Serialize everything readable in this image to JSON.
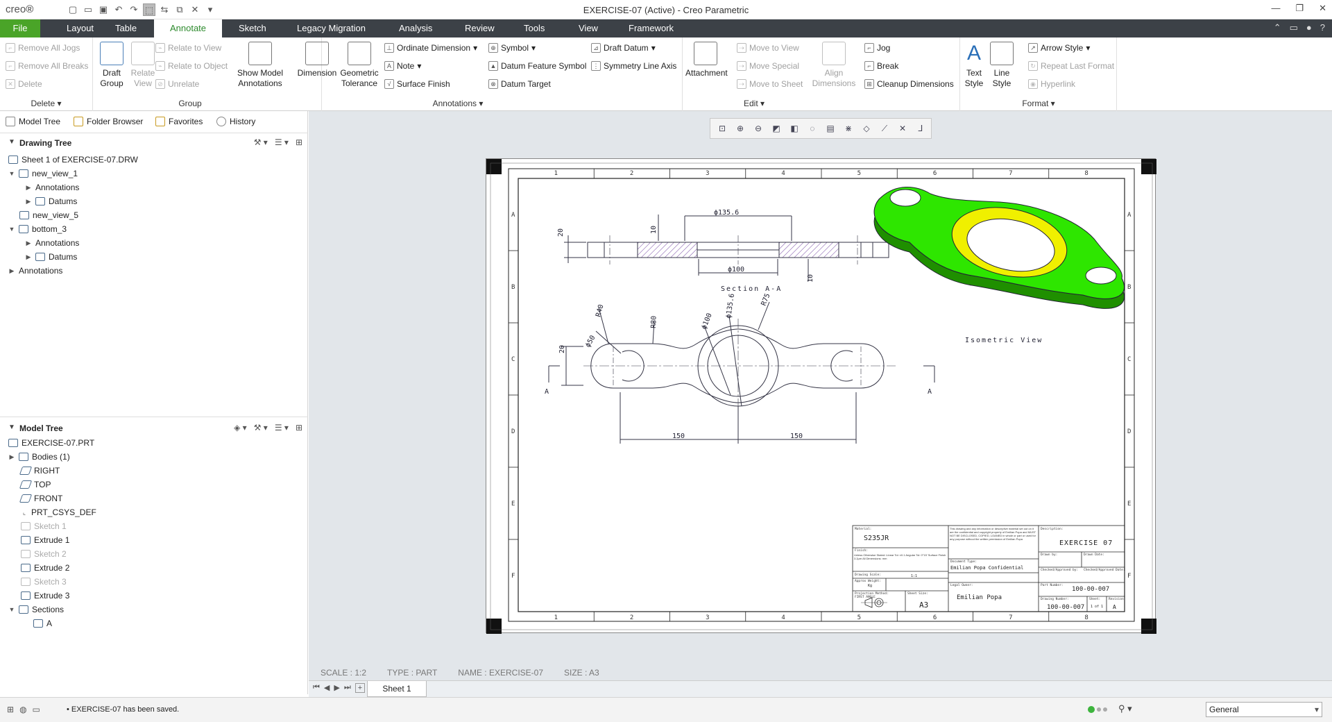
{
  "app": {
    "logo": "creo",
    "title": "EXERCISE-07 (Active) - Creo Parametric"
  },
  "tabs": [
    "File",
    "Layout",
    "Table",
    "Annotate",
    "Sketch",
    "Legacy Migration",
    "Analysis",
    "Review",
    "Tools",
    "View",
    "Framework"
  ],
  "ribbon": {
    "delete": {
      "items": [
        "Remove All Jogs",
        "Remove All Breaks",
        "Delete"
      ],
      "label": "Delete"
    },
    "group": {
      "draft_group": "Draft Group",
      "relate_view": "Relate View",
      "items": [
        "Relate to View",
        "Relate to Object",
        "Unrelate"
      ],
      "label": "Group"
    },
    "annotations": {
      "show_model": "Show Model Annotations",
      "dimension": "Dimension",
      "geometric_tolerance": "Geometric Tolerance",
      "ordinate": "Ordinate Dimension",
      "note": "Note",
      "surface_finish": "Surface Finish",
      "symbol": "Symbol",
      "datum_feature": "Datum Feature Symbol",
      "datum_target": "Datum Target",
      "draft_datum": "Draft Datum",
      "symmetry": "Symmetry Line Axis",
      "label": "Annotations"
    },
    "edit": {
      "attachment": "Attachment",
      "items": [
        "Move to View",
        "Move Special",
        "Move to Sheet"
      ],
      "align": "Align Dimensions",
      "jog": "Jog",
      "break": "Break",
      "cleanup": "Cleanup Dimensions",
      "label": "Edit"
    },
    "format": {
      "text_style": "Text Style",
      "line_style": "Line Style",
      "arrow_style": "Arrow Style",
      "repeat": "Repeat Last Format",
      "hyperlink": "Hyperlink",
      "label": "Format"
    }
  },
  "panel_tabs": [
    "Model Tree",
    "Folder Browser",
    "Favorites",
    "History"
  ],
  "drawing_tree": {
    "title": "Drawing Tree",
    "nodes": [
      "Sheet 1 of EXERCISE-07.DRW",
      "new_view_1",
      "Annotations",
      "Datums",
      "new_view_5",
      "bottom_3",
      "Annotations",
      "Datums",
      "Annotations"
    ]
  },
  "model_tree": {
    "title": "Model Tree",
    "nodes": [
      "EXERCISE-07.PRT",
      "Bodies (1)",
      "RIGHT",
      "TOP",
      "FRONT",
      "PRT_CSYS_DEF",
      "Sketch 1",
      "Extrude 1",
      "Sketch 2",
      "Extrude 2",
      "Sketch 3",
      "Extrude 3",
      "Sections",
      "A"
    ]
  },
  "drawing": {
    "section_label": "Section A-A",
    "iso_label": "Isometric View",
    "dims": {
      "d135_top": "ϕ135.6",
      "d100_top": "ϕ100",
      "h20": "20",
      "h10a": "10",
      "h10b": "10",
      "r50": "ϕ50",
      "r40": "R40",
      "r80": "R80",
      "d100": "ϕ100",
      "d135": "ϕ135.6",
      "r75": "R75",
      "v20": "20",
      "l150a": "150",
      "l150b": "150",
      "sec_a1": "A",
      "sec_a2": "A"
    },
    "cols": [
      "1",
      "2",
      "3",
      "4",
      "5",
      "6",
      "7",
      "8"
    ],
    "rows": [
      "A",
      "B",
      "C",
      "D",
      "E",
      "F"
    ],
    "title_block": {
      "material_label": "Material:",
      "material": "S235JR",
      "finish_label": "Finish:",
      "tolerance_text": "Unless Otherwise Stated: Linear Tol: ±0.1 Angular Tol: 0°15' Surface Finish 3.2μm All Dimensions: mm",
      "scale_label": "Drawing Scale:",
      "scale": "1:1",
      "mass_label": "Approx Weight:",
      "mass": "Kg",
      "projection_label": "Projection Method:",
      "projection": "FIRST ANGLE",
      "sheet_size_label": "Sheet Size:",
      "sheet_size": "A3",
      "confidential": "This drawing and any information or descriptive material set out on it are the confidential and copyright property of Emilian Popa and MUST NOT BE DISCLOSED, COPIED, LOANED in whole or part or used for any purpose without the written permission of Emilian Popa",
      "doc_type": "Document Type:",
      "company": "Emilian Popa Confidential",
      "legal_owner": "Legal Owner:",
      "owner": "Emilian Popa",
      "desc_label": "Description:",
      "description": "EXERCISE 07",
      "drawn_by": "Drawn by:",
      "drawn_date": "Drawn Date:",
      "checked": "Checked/Approved by:",
      "checked_date": "Checked/Approved Date:",
      "part_no_label": "Part Number:",
      "part_no": "100-00-007",
      "drawing_no_label": "Drawing Number:",
      "drawing_no": "100-00-007",
      "sheet_label": "Sheet:",
      "sheet": "1 of 1",
      "rev_label": "Revision:",
      "rev": "A"
    }
  },
  "sheet_info": [
    "SCALE : 1:2",
    "TYPE : PART",
    "NAME : EXERCISE-07",
    "SIZE : A3"
  ],
  "sheet_tab": "Sheet 1",
  "status": {
    "message": "EXERCISE-07 has been saved.",
    "filter": "General"
  },
  "colors": {
    "green": "#2ee600",
    "yellow": "#f0f000",
    "accent": "#4aa428"
  }
}
